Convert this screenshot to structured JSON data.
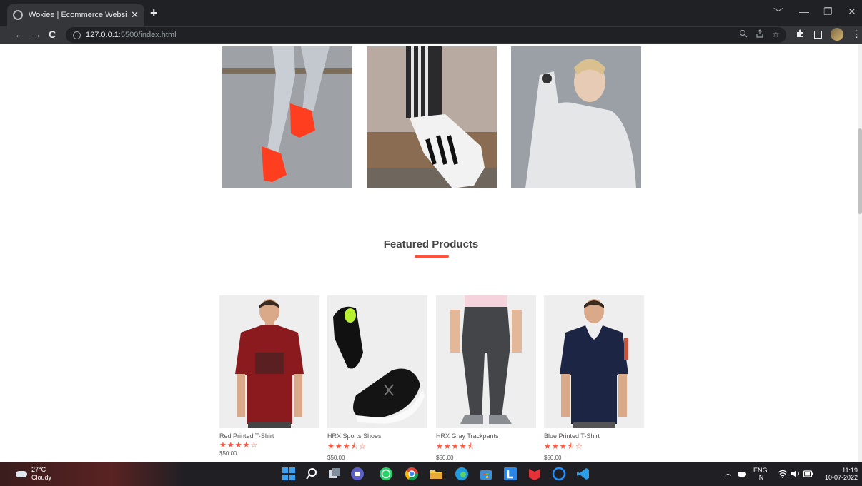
{
  "browser": {
    "tab_title": "Wokiee | Ecommerce Website de",
    "tab_close": "✕",
    "new_tab": "+",
    "url_host": "127.0.0.1",
    "url_path": ":5500/index.html",
    "window_controls": [
      "﹀",
      "—",
      "❐",
      "✕"
    ],
    "nav": [
      "←",
      "→",
      "C"
    ],
    "omni_icons": [
      "zoom-icon",
      "share-icon",
      "star-icon"
    ]
  },
  "featured": {
    "title": "Featured Products",
    "products": [
      {
        "name": "Red Printed T-Shirt",
        "stars": "★★★★☆",
        "rating": 4.0,
        "price": "$50.00",
        "color": "#8b1a1f"
      },
      {
        "name": "HRX Sports Shoes",
        "stars": "★★★⯪☆",
        "rating": 3.5,
        "price": "$50.00",
        "color": "#1a1a1a"
      },
      {
        "name": "HRX Gray Trackpants",
        "stars": "★★★★⯪",
        "rating": 4.5,
        "price": "$50.00",
        "color": "#444548"
      },
      {
        "name": "Blue Printed T-Shirt",
        "stars": "★★★⯪☆",
        "rating": 3.5,
        "price": "$50.00",
        "color": "#1d2545"
      }
    ]
  },
  "taskbar": {
    "temperature": "27°C",
    "condition": "Cloudy",
    "lang_top": "ENG",
    "lang_bottom": "IN",
    "time": "11:19",
    "date": "10-07-2022",
    "apps": [
      {
        "name": "start-icon",
        "color": "#3aa0f3"
      },
      {
        "name": "search-icon",
        "color": "#1f1f24"
      },
      {
        "name": "task-view-icon",
        "color": "#1f1f24"
      },
      {
        "name": "teams-icon",
        "color": "#5b5fc7"
      },
      {
        "name": "whatsapp-icon",
        "color": "#25d366"
      },
      {
        "name": "chrome-icon",
        "color": "#f4b400"
      },
      {
        "name": "file-explorer-icon",
        "color": "#f7c948"
      },
      {
        "name": "edge-icon",
        "color": "#1f9bde"
      },
      {
        "name": "store-icon",
        "color": "#3c8fdc"
      },
      {
        "name": "l-app-icon",
        "color": "#2b86e6"
      },
      {
        "name": "mcafee-icon",
        "color": "#e53238"
      },
      {
        "name": "cortana-icon",
        "color": "#1e90ff"
      },
      {
        "name": "vscode-icon",
        "color": "#2c9fe8"
      }
    ]
  }
}
